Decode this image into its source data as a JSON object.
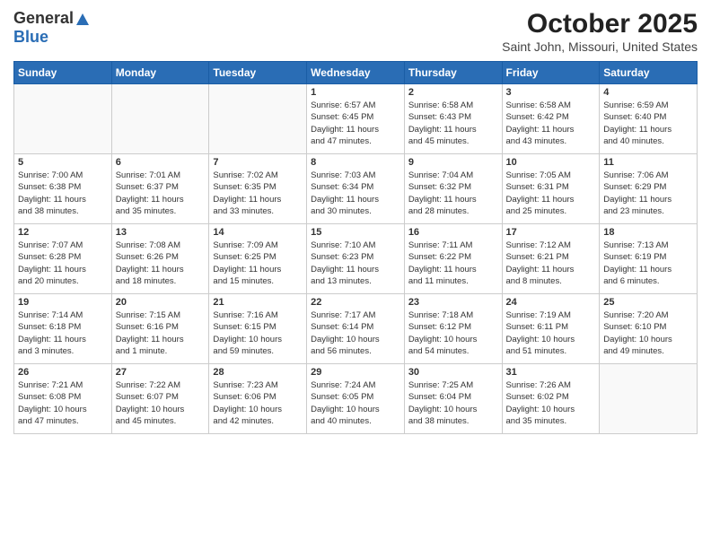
{
  "header": {
    "logo_general": "General",
    "logo_blue": "Blue",
    "month_title": "October 2025",
    "location": "Saint John, Missouri, United States"
  },
  "days_of_week": [
    "Sunday",
    "Monday",
    "Tuesday",
    "Wednesday",
    "Thursday",
    "Friday",
    "Saturday"
  ],
  "weeks": [
    [
      {
        "day": "",
        "info": ""
      },
      {
        "day": "",
        "info": ""
      },
      {
        "day": "",
        "info": ""
      },
      {
        "day": "1",
        "info": "Sunrise: 6:57 AM\nSunset: 6:45 PM\nDaylight: 11 hours\nand 47 minutes."
      },
      {
        "day": "2",
        "info": "Sunrise: 6:58 AM\nSunset: 6:43 PM\nDaylight: 11 hours\nand 45 minutes."
      },
      {
        "day": "3",
        "info": "Sunrise: 6:58 AM\nSunset: 6:42 PM\nDaylight: 11 hours\nand 43 minutes."
      },
      {
        "day": "4",
        "info": "Sunrise: 6:59 AM\nSunset: 6:40 PM\nDaylight: 11 hours\nand 40 minutes."
      }
    ],
    [
      {
        "day": "5",
        "info": "Sunrise: 7:00 AM\nSunset: 6:38 PM\nDaylight: 11 hours\nand 38 minutes."
      },
      {
        "day": "6",
        "info": "Sunrise: 7:01 AM\nSunset: 6:37 PM\nDaylight: 11 hours\nand 35 minutes."
      },
      {
        "day": "7",
        "info": "Sunrise: 7:02 AM\nSunset: 6:35 PM\nDaylight: 11 hours\nand 33 minutes."
      },
      {
        "day": "8",
        "info": "Sunrise: 7:03 AM\nSunset: 6:34 PM\nDaylight: 11 hours\nand 30 minutes."
      },
      {
        "day": "9",
        "info": "Sunrise: 7:04 AM\nSunset: 6:32 PM\nDaylight: 11 hours\nand 28 minutes."
      },
      {
        "day": "10",
        "info": "Sunrise: 7:05 AM\nSunset: 6:31 PM\nDaylight: 11 hours\nand 25 minutes."
      },
      {
        "day": "11",
        "info": "Sunrise: 7:06 AM\nSunset: 6:29 PM\nDaylight: 11 hours\nand 23 minutes."
      }
    ],
    [
      {
        "day": "12",
        "info": "Sunrise: 7:07 AM\nSunset: 6:28 PM\nDaylight: 11 hours\nand 20 minutes."
      },
      {
        "day": "13",
        "info": "Sunrise: 7:08 AM\nSunset: 6:26 PM\nDaylight: 11 hours\nand 18 minutes."
      },
      {
        "day": "14",
        "info": "Sunrise: 7:09 AM\nSunset: 6:25 PM\nDaylight: 11 hours\nand 15 minutes."
      },
      {
        "day": "15",
        "info": "Sunrise: 7:10 AM\nSunset: 6:23 PM\nDaylight: 11 hours\nand 13 minutes."
      },
      {
        "day": "16",
        "info": "Sunrise: 7:11 AM\nSunset: 6:22 PM\nDaylight: 11 hours\nand 11 minutes."
      },
      {
        "day": "17",
        "info": "Sunrise: 7:12 AM\nSunset: 6:21 PM\nDaylight: 11 hours\nand 8 minutes."
      },
      {
        "day": "18",
        "info": "Sunrise: 7:13 AM\nSunset: 6:19 PM\nDaylight: 11 hours\nand 6 minutes."
      }
    ],
    [
      {
        "day": "19",
        "info": "Sunrise: 7:14 AM\nSunset: 6:18 PM\nDaylight: 11 hours\nand 3 minutes."
      },
      {
        "day": "20",
        "info": "Sunrise: 7:15 AM\nSunset: 6:16 PM\nDaylight: 11 hours\nand 1 minute."
      },
      {
        "day": "21",
        "info": "Sunrise: 7:16 AM\nSunset: 6:15 PM\nDaylight: 10 hours\nand 59 minutes."
      },
      {
        "day": "22",
        "info": "Sunrise: 7:17 AM\nSunset: 6:14 PM\nDaylight: 10 hours\nand 56 minutes."
      },
      {
        "day": "23",
        "info": "Sunrise: 7:18 AM\nSunset: 6:12 PM\nDaylight: 10 hours\nand 54 minutes."
      },
      {
        "day": "24",
        "info": "Sunrise: 7:19 AM\nSunset: 6:11 PM\nDaylight: 10 hours\nand 51 minutes."
      },
      {
        "day": "25",
        "info": "Sunrise: 7:20 AM\nSunset: 6:10 PM\nDaylight: 10 hours\nand 49 minutes."
      }
    ],
    [
      {
        "day": "26",
        "info": "Sunrise: 7:21 AM\nSunset: 6:08 PM\nDaylight: 10 hours\nand 47 minutes."
      },
      {
        "day": "27",
        "info": "Sunrise: 7:22 AM\nSunset: 6:07 PM\nDaylight: 10 hours\nand 45 minutes."
      },
      {
        "day": "28",
        "info": "Sunrise: 7:23 AM\nSunset: 6:06 PM\nDaylight: 10 hours\nand 42 minutes."
      },
      {
        "day": "29",
        "info": "Sunrise: 7:24 AM\nSunset: 6:05 PM\nDaylight: 10 hours\nand 40 minutes."
      },
      {
        "day": "30",
        "info": "Sunrise: 7:25 AM\nSunset: 6:04 PM\nDaylight: 10 hours\nand 38 minutes."
      },
      {
        "day": "31",
        "info": "Sunrise: 7:26 AM\nSunset: 6:02 PM\nDaylight: 10 hours\nand 35 minutes."
      },
      {
        "day": "",
        "info": ""
      }
    ]
  ]
}
